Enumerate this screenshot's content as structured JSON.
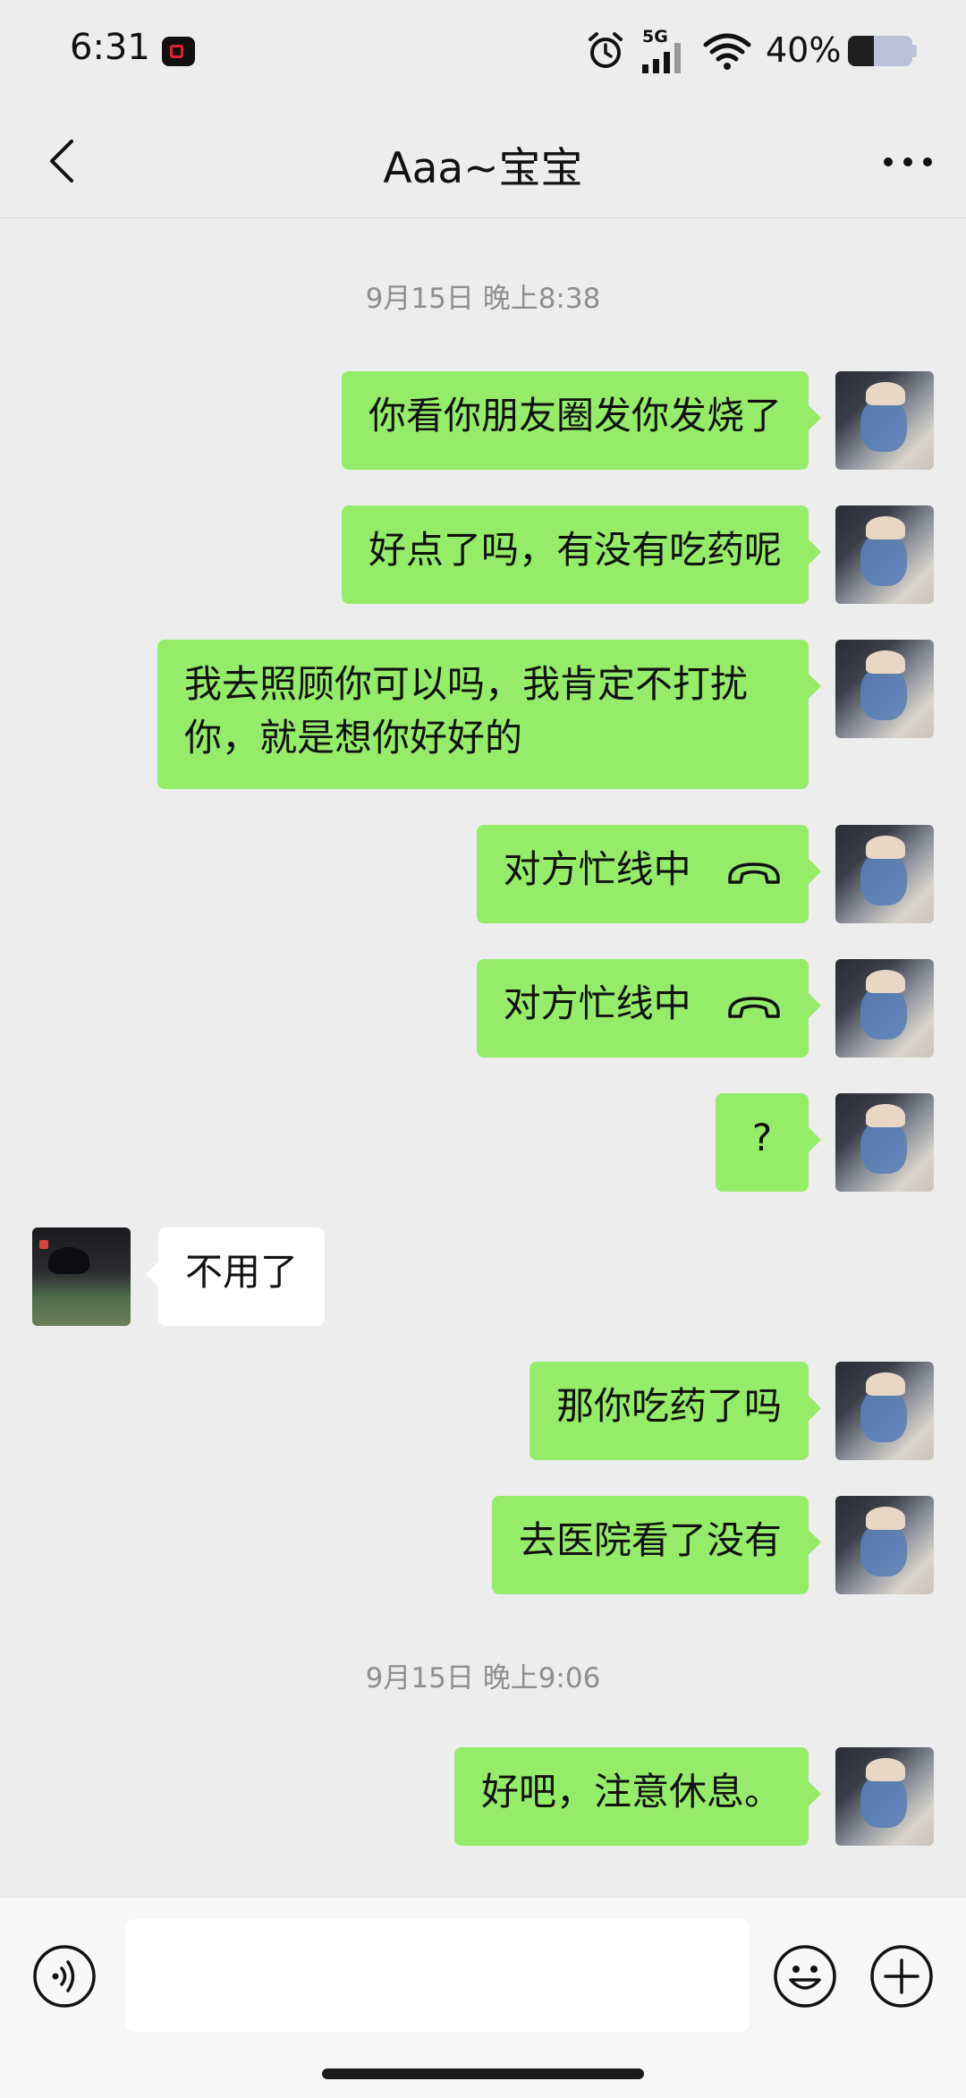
{
  "status_bar": {
    "time": "6:31",
    "network": "5G",
    "battery_percent": "40%",
    "battery_level": 0.4
  },
  "header": {
    "title": "Aaa~宝宝"
  },
  "chat": {
    "timestamps": [
      "9月15日 晚上8:38",
      "9月15日 晚上9:06"
    ],
    "messages": [
      {
        "sender": "me",
        "text": "你看你朋友圈发你发烧了"
      },
      {
        "sender": "me",
        "text": "好点了吗，有没有吃药呢"
      },
      {
        "sender": "me",
        "text": "我去照顾你可以吗，我肯定不打扰你，就是想你好好的"
      },
      {
        "sender": "me",
        "text": "对方忙线中",
        "icon": "hang-up-icon"
      },
      {
        "sender": "me",
        "text": "对方忙线中",
        "icon": "hang-up-icon"
      },
      {
        "sender": "me",
        "text": "?"
      },
      {
        "sender": "other",
        "text": "不用了"
      },
      {
        "sender": "me",
        "text": "那你吃药了吗"
      },
      {
        "sender": "me",
        "text": "去医院看了没有"
      },
      {
        "sender": "me",
        "text": "好吧，注意休息。"
      }
    ]
  },
  "input": {
    "value": "",
    "placeholder": ""
  },
  "colors": {
    "my_bubble": "#95ec69",
    "other_bubble": "#ffffff",
    "background": "#ededed"
  }
}
